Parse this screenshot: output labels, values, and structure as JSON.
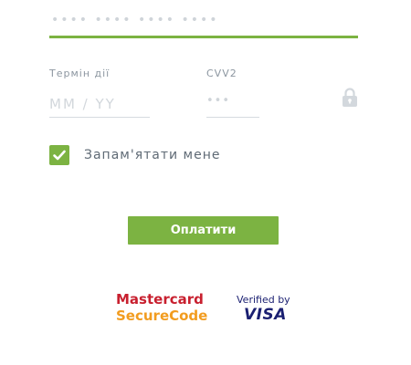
{
  "accent_color": "#7cb342",
  "card_number": {
    "mask": "•••• •••• •••• ••••"
  },
  "expiry": {
    "label": "Термін дії",
    "placeholder": "MM / YY",
    "value": ""
  },
  "cvv": {
    "label": "CVV2",
    "mask": "•••",
    "icon": "lock-icon"
  },
  "remember": {
    "label": "Запам'ятати мене",
    "checked": true,
    "icon": "checkmark-icon"
  },
  "pay_button": {
    "label": "Оплатити"
  },
  "logos": {
    "mastercard_line1": "Mastercard",
    "mastercard_line2": "SecureCode",
    "visa_line1": "Verified by",
    "visa_line2": "VISA"
  }
}
